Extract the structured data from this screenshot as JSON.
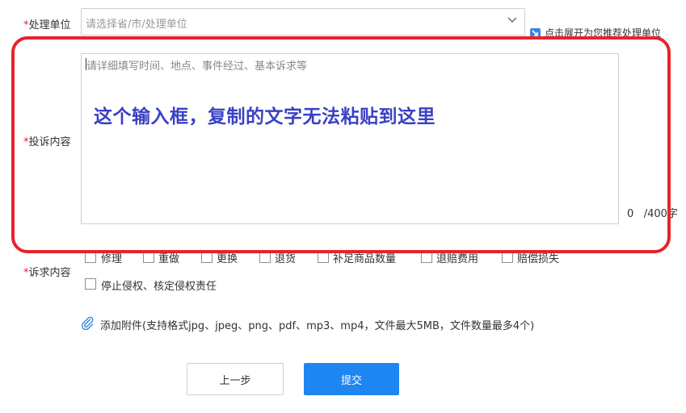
{
  "form": {
    "unit": {
      "required_mark": "*",
      "label": "处理单位",
      "placeholder": "请选择省/市/处理单位",
      "recommend_text": "点击展开为您推荐处理单位"
    },
    "content": {
      "required_mark": "*",
      "label": "投诉内容",
      "placeholder": "请详细填写时间、地点、事件经过、基本诉求等",
      "count": "0",
      "max": "/400字"
    },
    "demands": {
      "required_mark": "*",
      "label": "诉求内容",
      "options": [
        "修理",
        "重做",
        "更换",
        "退货",
        "补足商品数量",
        "退赔费用",
        "赔偿损失",
        "停止侵权、核定侵权责任"
      ]
    },
    "attachment": {
      "label": "添加附件(支持格式jpg、jpeg、png、pdf、mp3、mp4，文件最大5MB，文件数量最多4个)"
    }
  },
  "buttons": {
    "prev": "上一步",
    "submit": "提交"
  },
  "annotation": {
    "text": "这个输入框，复制的文字无法粘贴到这里",
    "frame_color": "#e8232b",
    "text_color": "#3b40c4"
  },
  "colors": {
    "primary": "#1e86f0",
    "required": "#e0242b"
  }
}
